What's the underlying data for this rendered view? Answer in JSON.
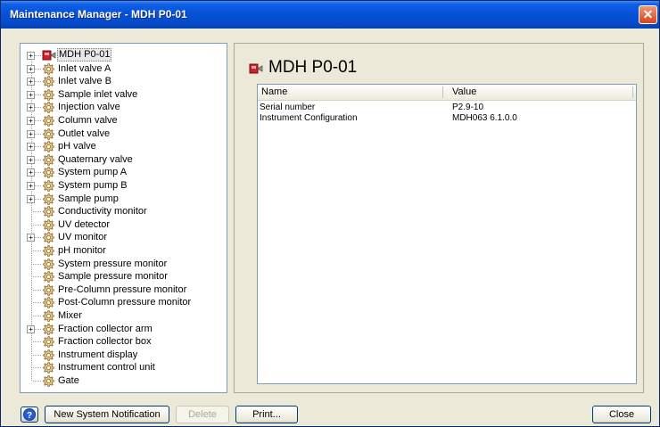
{
  "window": {
    "title": "Maintenance Manager - MDH P0-01",
    "close_glyph": "✕"
  },
  "tree": {
    "items": [
      {
        "label": "MDH P0-01",
        "expandable": true,
        "icon": "instrument-icon",
        "selected": true
      },
      {
        "label": "Inlet valve A",
        "expandable": true,
        "icon": "gear-icon"
      },
      {
        "label": "Inlet valve B",
        "expandable": true,
        "icon": "gear-icon"
      },
      {
        "label": "Sample inlet valve",
        "expandable": true,
        "icon": "gear-icon"
      },
      {
        "label": "Injection valve",
        "expandable": true,
        "icon": "gear-icon"
      },
      {
        "label": "Column valve",
        "expandable": true,
        "icon": "gear-icon"
      },
      {
        "label": "Outlet valve",
        "expandable": true,
        "icon": "gear-icon"
      },
      {
        "label": "pH valve",
        "expandable": true,
        "icon": "gear-icon"
      },
      {
        "label": "Quaternary valve",
        "expandable": true,
        "icon": "gear-icon"
      },
      {
        "label": "System pump A",
        "expandable": true,
        "icon": "gear-icon"
      },
      {
        "label": "System pump B",
        "expandable": true,
        "icon": "gear-icon"
      },
      {
        "label": "Sample pump",
        "expandable": true,
        "icon": "gear-icon"
      },
      {
        "label": "Conductivity monitor",
        "expandable": false,
        "icon": "gear-icon"
      },
      {
        "label": "UV detector",
        "expandable": false,
        "icon": "gear-icon"
      },
      {
        "label": "UV monitor",
        "expandable": true,
        "icon": "gear-icon"
      },
      {
        "label": "pH monitor",
        "expandable": false,
        "icon": "gear-icon"
      },
      {
        "label": "System pressure monitor",
        "expandable": false,
        "icon": "gear-icon"
      },
      {
        "label": "Sample pressure monitor",
        "expandable": false,
        "icon": "gear-icon"
      },
      {
        "label": "Pre-Column pressure monitor",
        "expandable": false,
        "icon": "gear-icon"
      },
      {
        "label": "Post-Column pressure monitor",
        "expandable": false,
        "icon": "gear-icon"
      },
      {
        "label": "Mixer",
        "expandable": false,
        "icon": "gear-icon"
      },
      {
        "label": "Fraction collector arm",
        "expandable": true,
        "icon": "gear-icon"
      },
      {
        "label": "Fraction collector box",
        "expandable": false,
        "icon": "gear-icon"
      },
      {
        "label": "Instrument display",
        "expandable": false,
        "icon": "gear-icon"
      },
      {
        "label": "Instrument control unit",
        "expandable": false,
        "icon": "gear-icon"
      },
      {
        "label": "Gate",
        "expandable": false,
        "icon": "gear-icon"
      }
    ]
  },
  "detail": {
    "title": "MDH P0-01",
    "columns": [
      "Name",
      "Value"
    ],
    "rows": [
      {
        "name": "Serial number",
        "value": "P2.9-10"
      },
      {
        "name": "Instrument Configuration",
        "value": "MDH063 6.1.0.0"
      }
    ]
  },
  "buttons": {
    "help_glyph": "?",
    "new_notification": "New System Notification",
    "delete": "Delete",
    "print": "Print...",
    "close": "Close"
  },
  "colors": {
    "title_bar": "#0551d6",
    "window_bg": "#ece9d8",
    "close_button": "#d2461e",
    "instrument_icon": "#d0202a"
  }
}
